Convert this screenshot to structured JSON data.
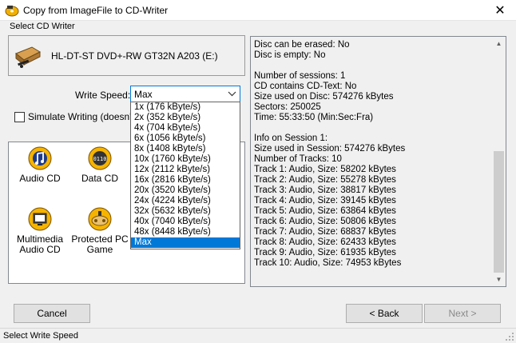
{
  "window": {
    "title": "Copy from ImageFile to CD-Writer",
    "close_glyph": "✕",
    "icon": "cd-writer-app-icon"
  },
  "writer_group": {
    "label": "Select CD Writer"
  },
  "drive": {
    "name": "HL-DT-ST DVD+-RW GT32N A203 (E:)",
    "icon": "optical-drive-icon"
  },
  "write_speed": {
    "label": "Write Speed:",
    "value": "Max",
    "options": [
      "1x (176 kByte/s)",
      "2x (352 kByte/s)",
      "4x (704 kByte/s)",
      "6x (1056 kByte/s)",
      "8x (1408 kByte/s)",
      "10x (1760 kByte/s)",
      "12x (2112 kByte/s)",
      "16x (2816 kByte/s)",
      "20x (3520 kByte/s)",
      "24x (4224 kByte/s)",
      "32x (5632 kByte/s)",
      "40x (7040 kByte/s)",
      "48x (8448 kByte/s)",
      "Max"
    ],
    "selected_index": 13
  },
  "simulate": {
    "label": "Simulate Writing (doesn't w",
    "checked": false
  },
  "icons": [
    {
      "label": "Audio CD",
      "icon": "audio-cd-icon"
    },
    {
      "label": "Data CD",
      "icon": "data-cd-icon"
    },
    {
      "label": "Multimedia Audio CD",
      "label_line1": "Multimedia",
      "label_line2": "Audio CD",
      "icon": "multimedia-audio-cd-icon"
    },
    {
      "label": "Protected PC Game",
      "label_line1": "Protected PC",
      "label_line2": "Game",
      "icon": "protected-pc-game-icon"
    }
  ],
  "disc_info": {
    "lines": [
      "Disc can be erased: No",
      "Disc is empty: No",
      "",
      "Number of sessions: 1",
      "CD contains CD-Text: No",
      "Size used on Disc: 574276 kBytes",
      "Sectors: 250025",
      "Time: 55:33:50 (Min:Sec:Fra)",
      "",
      "Info on Session 1:",
      "Size used in Session: 574276 kBytes",
      "Number of Tracks: 10",
      "Track 1: Audio, Size: 58202 kBytes",
      "Track 2: Audio, Size: 55278 kBytes",
      "Track 3: Audio, Size: 38817 kBytes",
      "Track 4: Audio, Size: 39145 kBytes",
      "Track 5: Audio, Size: 63864 kBytes",
      "Track 6: Audio, Size: 50806 kBytes",
      "Track 7: Audio, Size: 68837 kBytes",
      "Track 8: Audio, Size: 62433 kBytes",
      "Track 9: Audio, Size: 61935 kBytes",
      "Track 10: Audio, Size: 74953 kBytes"
    ]
  },
  "buttons": {
    "cancel": "Cancel",
    "back": "< Back",
    "next": "Next >"
  },
  "status": {
    "text": "Select Write Speed"
  },
  "colors": {
    "accent": "#0078d7",
    "panel_bg": "#f0f0f0",
    "button_bg": "#e1e1e1"
  }
}
